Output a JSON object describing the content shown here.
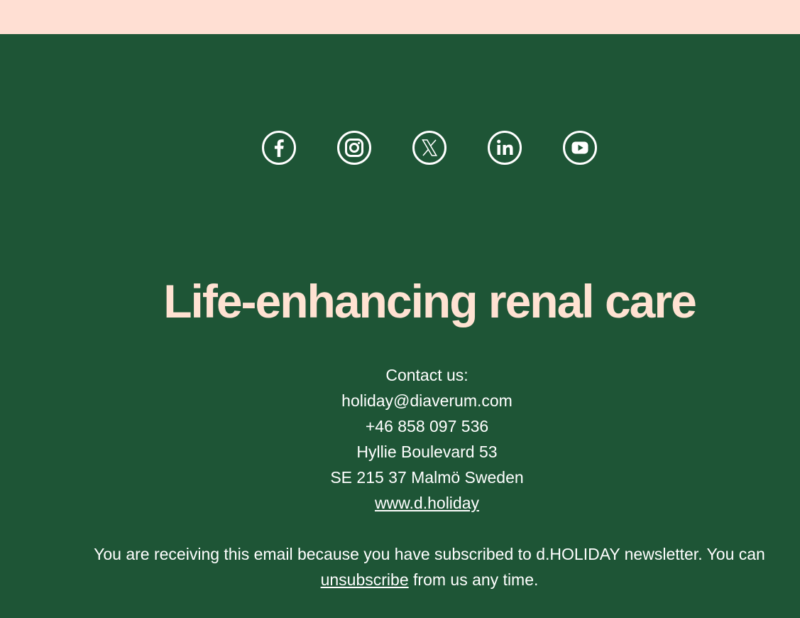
{
  "colors": {
    "top_band": "#ffdfd3",
    "footer_background": "#1e5536",
    "tagline": "#ffe2d2",
    "text": "#ffffff"
  },
  "social": [
    {
      "name": "Facebook",
      "icon": "facebook-icon"
    },
    {
      "name": "Instagram",
      "icon": "instagram-icon"
    },
    {
      "name": "X",
      "icon": "x-icon"
    },
    {
      "name": "LinkedIn",
      "icon": "linkedin-icon"
    },
    {
      "name": "YouTube",
      "icon": "youtube-icon"
    }
  ],
  "tagline": "Life-enhancing renal care",
  "contact": {
    "heading": "Contact us:",
    "email": "holiday@diaverum.com",
    "phone": "+46 858 097 536",
    "street": "Hyllie Boulevard 53",
    "city": "SE 215 37 Malmö Sweden",
    "website": "www.d.holiday"
  },
  "legal": {
    "text_before": "You are receiving this email because you have subscribed to d.HOLIDAY newsletter. You can ",
    "unsubscribe_label": "unsubscribe",
    "text_after": " from us any time."
  }
}
